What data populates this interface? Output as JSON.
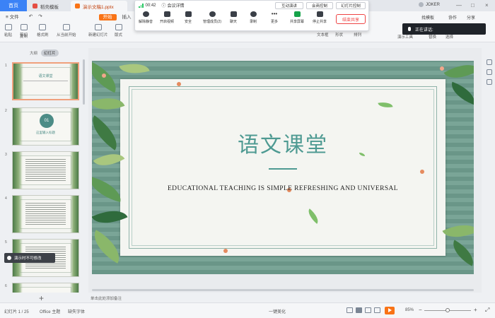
{
  "tabs": {
    "home": "首页",
    "items": [
      {
        "label": "稻壳模板",
        "color": "#e54d42"
      },
      {
        "label": "演示文稿1.pptx",
        "color": "#f97316"
      }
    ]
  },
  "menu": {
    "file": "≡ 文件",
    "start": "开始",
    "insert": "插入"
  },
  "ribbon": {
    "buttons": [
      "粘贴",
      "剪切",
      "复制",
      "格式刷",
      "从当前开始",
      "新建幻灯片",
      "版式",
      "文本框",
      "形状",
      "排列",
      "演示工具",
      "替换",
      "选择"
    ]
  },
  "meeting": {
    "time": "00:42",
    "title": "会议详情",
    "interactive_control": "互动演讲",
    "speak_control": "会商控制",
    "slide_control": "幻灯片控制",
    "tools": [
      "解除静音",
      "开启视频",
      "安全",
      "管理成员(2)",
      "聊天",
      "录制",
      "更多",
      "共享屏幕",
      "停止共享"
    ],
    "end_button": "结束共享"
  },
  "right_top": {
    "user": "JOKER",
    "find_template": "找模板",
    "collab": "协作",
    "share": "分享"
  },
  "speaking_banner": "正在讲话:",
  "panel": {
    "tab_outline": "大纲",
    "tab_slides": "幻灯片",
    "thumb_numbers": [
      "1",
      "2",
      "3",
      "4",
      "5",
      "6"
    ],
    "thumb1_title": "语文课堂",
    "thumb2_number": "01",
    "thumb2_label": "这里输入标题",
    "add_symbol": "+"
  },
  "tooltip": "演示时不可修改",
  "slide": {
    "title": "语文课堂",
    "subtitle": "EDUCATIONAL TEACHING IS SIMPLE REFRESHING AND UNIVERSAL"
  },
  "notes_placeholder": "单击此处添加备注",
  "status": {
    "slide_count": "幻灯片 1 / 25",
    "theme": "Office 主题",
    "missing_font": "缺失字体",
    "beautify": "一键美化",
    "zoom": "85%"
  },
  "colors": {
    "accent": "#f97316",
    "title_teal": "#4e9a92",
    "tab_blue": "#3b82f6"
  }
}
